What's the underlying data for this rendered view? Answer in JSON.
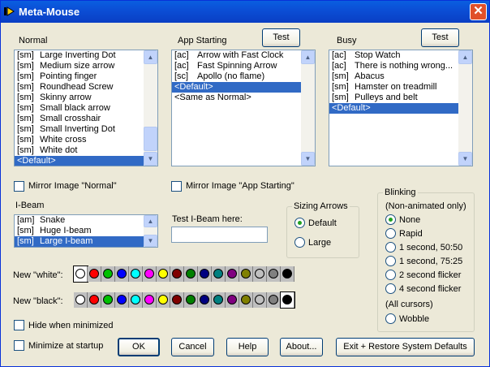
{
  "window": {
    "title": "Meta-Mouse",
    "close_glyph": "✕"
  },
  "normal": {
    "label": "Normal",
    "items": [
      {
        "tag": "[sm]",
        "name": "Large Inverting Dot"
      },
      {
        "tag": "[sm]",
        "name": "Medium size arrow"
      },
      {
        "tag": "[sm]",
        "name": "Pointing finger"
      },
      {
        "tag": "[sm]",
        "name": "Roundhead Screw"
      },
      {
        "tag": "[sm]",
        "name": "Skinny arrow"
      },
      {
        "tag": "[sm]",
        "name": "Small black arrow"
      },
      {
        "tag": "[sm]",
        "name": "Small crosshair"
      },
      {
        "tag": "[sm]",
        "name": "Small Inverting Dot"
      },
      {
        "tag": "[sm]",
        "name": "White cross"
      },
      {
        "tag": "[sm]",
        "name": "White dot"
      },
      {
        "tag": "",
        "name": "<Default>",
        "selected": true
      }
    ],
    "mirror_label": "Mirror Image \"Normal\""
  },
  "app_starting": {
    "label": "App Starting",
    "test_label": "Test",
    "items": [
      {
        "tag": "[ac]",
        "name": "Arrow with Fast Clock"
      },
      {
        "tag": "[ac]",
        "name": "Fast Spinning Arrow"
      },
      {
        "tag": "[sc]",
        "name": "Apollo (no flame)"
      },
      {
        "tag": "",
        "name": "<Default>",
        "selected": true
      },
      {
        "tag": "",
        "name": "<Same as Normal>"
      }
    ],
    "mirror_label": "Mirror Image \"App Starting\""
  },
  "busy": {
    "label": "Busy",
    "test_label": "Test",
    "items": [
      {
        "tag": "[ac]",
        "name": "Stop Watch"
      },
      {
        "tag": "[ac]",
        "name": "There is nothing wrong..."
      },
      {
        "tag": "[sm]",
        "name": "Abacus"
      },
      {
        "tag": "[sm]",
        "name": "Hamster on treadmill"
      },
      {
        "tag": "[sm]",
        "name": "Pulleys and belt"
      },
      {
        "tag": "",
        "name": "<Default>",
        "selected": true
      }
    ]
  },
  "ibeam": {
    "label": "I-Beam",
    "items": [
      {
        "tag": "[am]",
        "name": "Snake"
      },
      {
        "tag": "[sm]",
        "name": "Huge I-beam"
      },
      {
        "tag": "[sm]",
        "name": "Large I-beam",
        "selected": true
      }
    ],
    "test_label": "Test I-Beam here:",
    "test_value": ""
  },
  "sizing": {
    "label": "Sizing Arrows",
    "options": [
      "Default",
      "Large"
    ],
    "selected": 0
  },
  "blinking": {
    "label": "Blinking",
    "sublabel": "(Non-animated only)",
    "options": [
      "None",
      "Rapid",
      "1 second, 50:50",
      "1 second, 75:25",
      "2 second flicker",
      "4 second flicker"
    ],
    "selected": 0,
    "all_label": "(All cursors)",
    "wobble_label": "Wobble"
  },
  "colors": {
    "white_label": "New \"white\":",
    "black_label": "New \"black\":",
    "palette": [
      "#ffffff",
      "#ff0000",
      "#00c000",
      "#0000ff",
      "#00ffff",
      "#ff00ff",
      "#ffff00",
      "#800000",
      "#008000",
      "#000080",
      "#008080",
      "#800080",
      "#808000",
      "#c0c0c0",
      "#808080",
      "#000000"
    ],
    "white_selected": 0,
    "black_selected": 15
  },
  "options": {
    "hide_label": "Hide when minimized",
    "minimize_label": "Minimize at startup"
  },
  "buttons": {
    "ok": "OK",
    "cancel": "Cancel",
    "help": "Help",
    "about": "About...",
    "exit_restore": "Exit + Restore System Defaults"
  }
}
